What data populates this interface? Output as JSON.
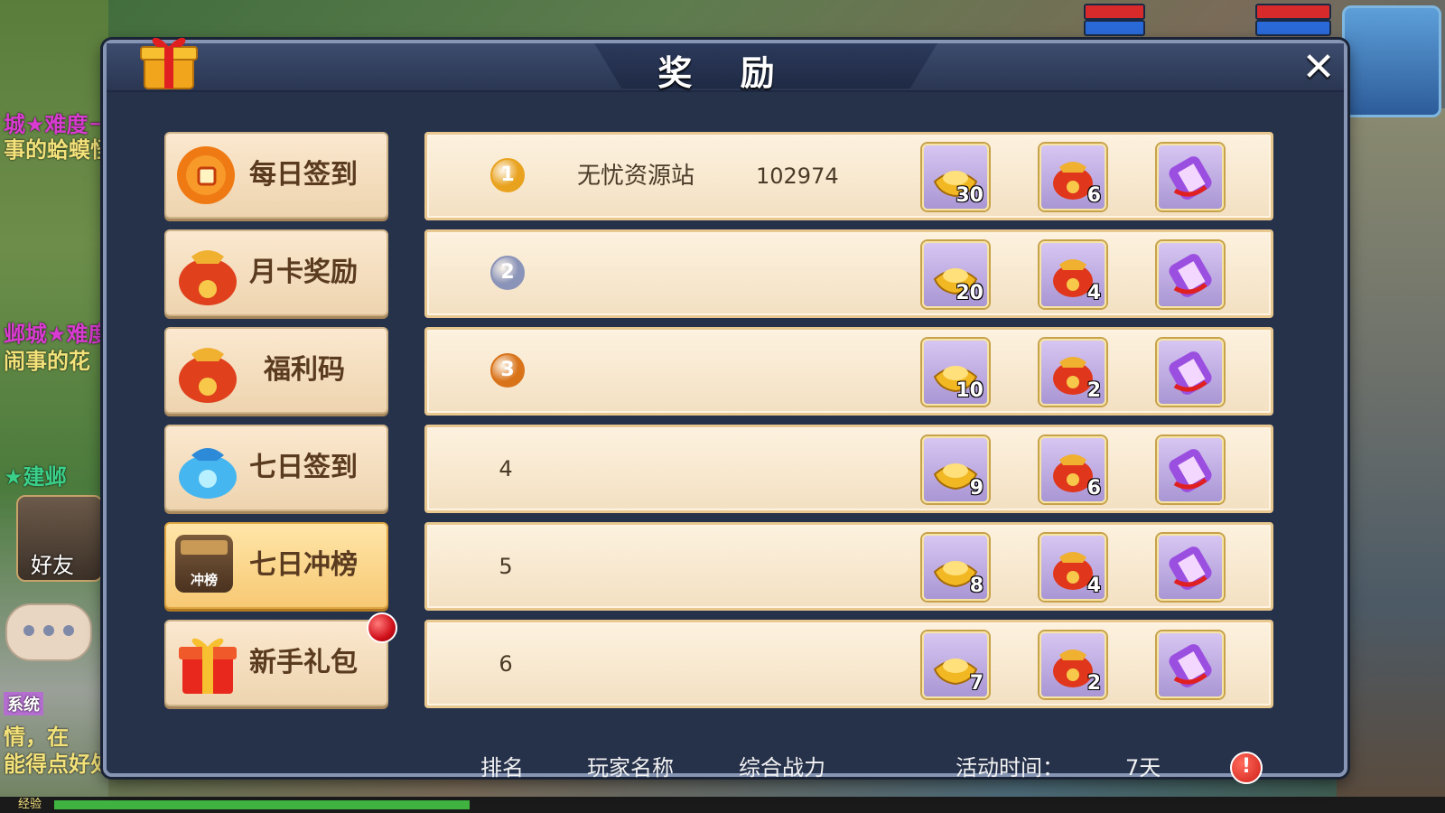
{
  "background": {
    "left_texts": [
      "城★难度－",
      "事的蛤蟆怪",
      "邺城★难度",
      "闹事的花",
      "★建邺",
      "系统",
      "情，在",
      "能得点好处呢。"
    ],
    "bottom_text": "经验",
    "friend_label": "好友"
  },
  "dialog": {
    "title": "奖 励",
    "close_label": "✕"
  },
  "sidebar": [
    {
      "label": "每日签到",
      "icon": "sun-coin-icon",
      "active": false
    },
    {
      "label": "月卡奖励",
      "icon": "lucky-bag-icon",
      "active": false
    },
    {
      "label": "福利码",
      "icon": "lucky-bag-icon",
      "active": false
    },
    {
      "label": "七日签到",
      "icon": "blue-bag-icon",
      "active": false
    },
    {
      "label": "七日冲榜",
      "icon": "ranking-icon",
      "icon_text": "冲榜",
      "active": true
    },
    {
      "label": "新手礼包",
      "icon": "gift-box-icon",
      "active": false,
      "badge": true
    }
  ],
  "rows": [
    {
      "rank": "1",
      "medal": "gold",
      "player": "无忧资源站",
      "power": "102974",
      "rewards": [
        {
          "type": "gold-ingot",
          "count": "30"
        },
        {
          "type": "lucky-bag",
          "count": "6"
        },
        {
          "type": "scroll",
          "count": ""
        }
      ]
    },
    {
      "rank": "2",
      "medal": "silver",
      "player": "",
      "power": "",
      "rewards": [
        {
          "type": "gold-ingot",
          "count": "20"
        },
        {
          "type": "lucky-bag",
          "count": "4"
        },
        {
          "type": "scroll",
          "count": ""
        }
      ]
    },
    {
      "rank": "3",
      "medal": "bronze",
      "player": "",
      "power": "",
      "rewards": [
        {
          "type": "gold-ingot",
          "count": "10"
        },
        {
          "type": "lucky-bag",
          "count": "2"
        },
        {
          "type": "scroll",
          "count": ""
        }
      ]
    },
    {
      "rank": "4",
      "medal": "",
      "player": "",
      "power": "",
      "rewards": [
        {
          "type": "gold-ingot",
          "count": "9"
        },
        {
          "type": "lucky-bag",
          "count": "6"
        },
        {
          "type": "scroll",
          "count": ""
        }
      ]
    },
    {
      "rank": "5",
      "medal": "",
      "player": "",
      "power": "",
      "rewards": [
        {
          "type": "gold-ingot",
          "count": "8"
        },
        {
          "type": "lucky-bag",
          "count": "4"
        },
        {
          "type": "scroll",
          "count": ""
        }
      ]
    },
    {
      "rank": "6",
      "medal": "",
      "player": "",
      "power": "",
      "rewards": [
        {
          "type": "gold-ingot",
          "count": "7"
        },
        {
          "type": "lucky-bag",
          "count": "2"
        },
        {
          "type": "scroll",
          "count": ""
        }
      ]
    }
  ],
  "footer": {
    "rank_header": "排名",
    "name_header": "玩家名称",
    "power_header": "综合战力",
    "time_label": "活动时间：",
    "time_value": "7天",
    "info_label": "!"
  },
  "colors": {
    "dialog_bg": "#26314a",
    "row_bg": "#f3e0c2",
    "active_tab": "#f7c974",
    "gold_medal": "#e9a21e",
    "silver_medal": "#8a93b8",
    "bronze_medal": "#d9731a"
  }
}
